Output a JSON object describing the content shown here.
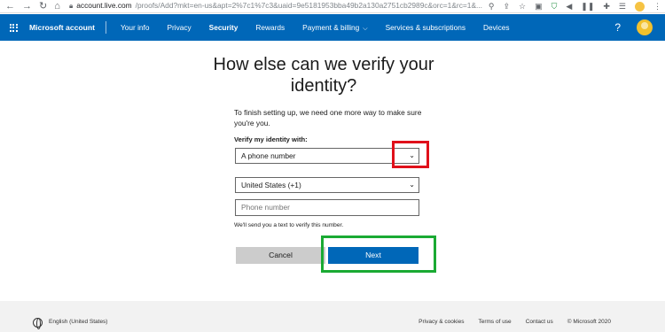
{
  "browser": {
    "url_host": "account.live.com",
    "url_rest": "/proofs/Add?mkt=en-us&apt=2%7c1%7c3&uaid=9e5181953bba49b2a130a2751cb2989c&orc=1&rc=1&...",
    "icons": [
      "back-icon",
      "forward-icon",
      "reload-icon",
      "home-icon",
      "lock-icon",
      "zoom-icon",
      "share-icon",
      "star-icon"
    ]
  },
  "topbar": {
    "brand": "Microsoft account",
    "nav": [
      "Your info",
      "Privacy",
      "Security",
      "Rewards",
      "Payment & billing",
      "Services & subscriptions",
      "Devices"
    ],
    "active": "Security",
    "help": "?",
    "color": "#0067b8"
  },
  "main": {
    "title": "How else can we verify your identity?",
    "description": "To finish setting up, we need one more way to make sure you're you.",
    "verify_label": "Verify my identity with:",
    "method_value": "A phone number",
    "country_value": "United States (+1)",
    "phone_placeholder": "Phone number",
    "hint": "We'll send you a text to verify this number.",
    "cancel_label": "Cancel",
    "next_label": "Next"
  },
  "footer": {
    "locale": "English (United States)",
    "links": [
      "Privacy & cookies",
      "Terms of use",
      "Contact us",
      "© Microsoft 2020"
    ]
  }
}
